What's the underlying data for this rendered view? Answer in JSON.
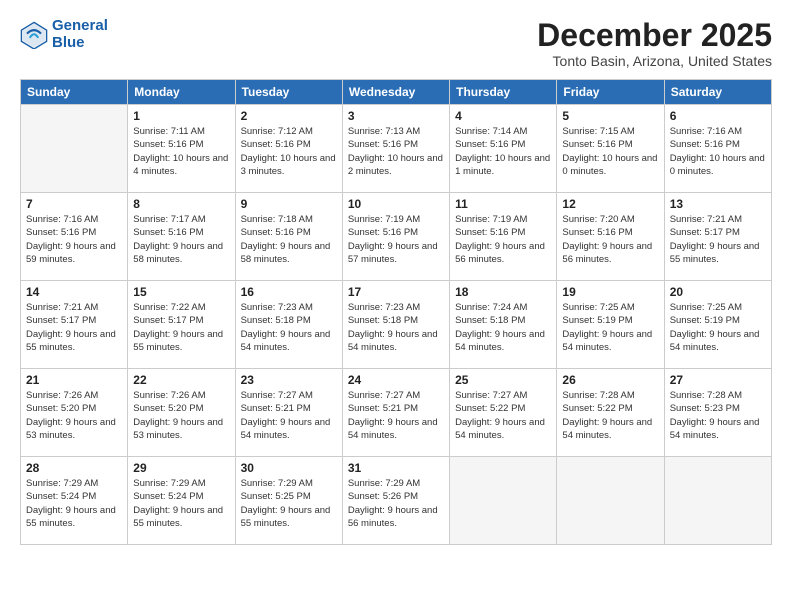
{
  "logo": {
    "line1": "General",
    "line2": "Blue"
  },
  "title": "December 2025",
  "location": "Tonto Basin, Arizona, United States",
  "days_header": [
    "Sunday",
    "Monday",
    "Tuesday",
    "Wednesday",
    "Thursday",
    "Friday",
    "Saturday"
  ],
  "weeks": [
    [
      {
        "day": "",
        "empty": true
      },
      {
        "day": "1",
        "sunrise": "7:11 AM",
        "sunset": "5:16 PM",
        "daylight": "10 hours and 4 minutes."
      },
      {
        "day": "2",
        "sunrise": "7:12 AM",
        "sunset": "5:16 PM",
        "daylight": "10 hours and 3 minutes."
      },
      {
        "day": "3",
        "sunrise": "7:13 AM",
        "sunset": "5:16 PM",
        "daylight": "10 hours and 2 minutes."
      },
      {
        "day": "4",
        "sunrise": "7:14 AM",
        "sunset": "5:16 PM",
        "daylight": "10 hours and 1 minute."
      },
      {
        "day": "5",
        "sunrise": "7:15 AM",
        "sunset": "5:16 PM",
        "daylight": "10 hours and 0 minutes."
      },
      {
        "day": "6",
        "sunrise": "7:16 AM",
        "sunset": "5:16 PM",
        "daylight": "10 hours and 0 minutes."
      }
    ],
    [
      {
        "day": "7",
        "sunrise": "7:16 AM",
        "sunset": "5:16 PM",
        "daylight": "9 hours and 59 minutes."
      },
      {
        "day": "8",
        "sunrise": "7:17 AM",
        "sunset": "5:16 PM",
        "daylight": "9 hours and 58 minutes."
      },
      {
        "day": "9",
        "sunrise": "7:18 AM",
        "sunset": "5:16 PM",
        "daylight": "9 hours and 58 minutes."
      },
      {
        "day": "10",
        "sunrise": "7:19 AM",
        "sunset": "5:16 PM",
        "daylight": "9 hours and 57 minutes."
      },
      {
        "day": "11",
        "sunrise": "7:19 AM",
        "sunset": "5:16 PM",
        "daylight": "9 hours and 56 minutes."
      },
      {
        "day": "12",
        "sunrise": "7:20 AM",
        "sunset": "5:16 PM",
        "daylight": "9 hours and 56 minutes."
      },
      {
        "day": "13",
        "sunrise": "7:21 AM",
        "sunset": "5:17 PM",
        "daylight": "9 hours and 55 minutes."
      }
    ],
    [
      {
        "day": "14",
        "sunrise": "7:21 AM",
        "sunset": "5:17 PM",
        "daylight": "9 hours and 55 minutes."
      },
      {
        "day": "15",
        "sunrise": "7:22 AM",
        "sunset": "5:17 PM",
        "daylight": "9 hours and 55 minutes."
      },
      {
        "day": "16",
        "sunrise": "7:23 AM",
        "sunset": "5:18 PM",
        "daylight": "9 hours and 54 minutes."
      },
      {
        "day": "17",
        "sunrise": "7:23 AM",
        "sunset": "5:18 PM",
        "daylight": "9 hours and 54 minutes."
      },
      {
        "day": "18",
        "sunrise": "7:24 AM",
        "sunset": "5:18 PM",
        "daylight": "9 hours and 54 minutes."
      },
      {
        "day": "19",
        "sunrise": "7:25 AM",
        "sunset": "5:19 PM",
        "daylight": "9 hours and 54 minutes."
      },
      {
        "day": "20",
        "sunrise": "7:25 AM",
        "sunset": "5:19 PM",
        "daylight": "9 hours and 54 minutes."
      }
    ],
    [
      {
        "day": "21",
        "sunrise": "7:26 AM",
        "sunset": "5:20 PM",
        "daylight": "9 hours and 53 minutes."
      },
      {
        "day": "22",
        "sunrise": "7:26 AM",
        "sunset": "5:20 PM",
        "daylight": "9 hours and 53 minutes."
      },
      {
        "day": "23",
        "sunrise": "7:27 AM",
        "sunset": "5:21 PM",
        "daylight": "9 hours and 54 minutes."
      },
      {
        "day": "24",
        "sunrise": "7:27 AM",
        "sunset": "5:21 PM",
        "daylight": "9 hours and 54 minutes."
      },
      {
        "day": "25",
        "sunrise": "7:27 AM",
        "sunset": "5:22 PM",
        "daylight": "9 hours and 54 minutes."
      },
      {
        "day": "26",
        "sunrise": "7:28 AM",
        "sunset": "5:22 PM",
        "daylight": "9 hours and 54 minutes."
      },
      {
        "day": "27",
        "sunrise": "7:28 AM",
        "sunset": "5:23 PM",
        "daylight": "9 hours and 54 minutes."
      }
    ],
    [
      {
        "day": "28",
        "sunrise": "7:29 AM",
        "sunset": "5:24 PM",
        "daylight": "9 hours and 55 minutes."
      },
      {
        "day": "29",
        "sunrise": "7:29 AM",
        "sunset": "5:24 PM",
        "daylight": "9 hours and 55 minutes."
      },
      {
        "day": "30",
        "sunrise": "7:29 AM",
        "sunset": "5:25 PM",
        "daylight": "9 hours and 55 minutes."
      },
      {
        "day": "31",
        "sunrise": "7:29 AM",
        "sunset": "5:26 PM",
        "daylight": "9 hours and 56 minutes."
      },
      {
        "day": "",
        "empty": true
      },
      {
        "day": "",
        "empty": true
      },
      {
        "day": "",
        "empty": true
      }
    ]
  ]
}
